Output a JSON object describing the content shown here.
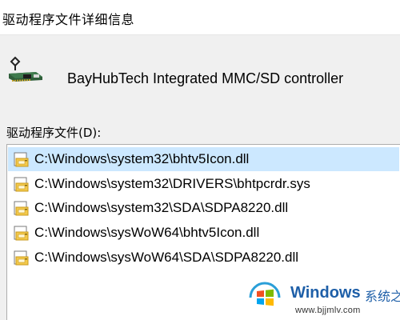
{
  "window": {
    "title": "驱动程序文件详细信息"
  },
  "device": {
    "icon": "controller-card-icon",
    "name": "BayHubTech Integrated MMC/SD controller"
  },
  "files": {
    "label": "驱动程序文件(D):",
    "selected_index": 0,
    "items": [
      {
        "path": "C:\\Windows\\system32\\bhtv5Icon.dll",
        "icon": "driver-file-icon"
      },
      {
        "path": "C:\\Windows\\system32\\DRIVERS\\bhtpcrdr.sys",
        "icon": "driver-file-icon"
      },
      {
        "path": "C:\\Windows\\system32\\SDA\\SDPA8220.dll",
        "icon": "driver-file-icon"
      },
      {
        "path": "C:\\Windows\\sysWoW64\\bhtv5Icon.dll",
        "icon": "driver-file-icon"
      },
      {
        "path": "C:\\Windows\\sysWoW64\\SDA\\SDPA8220.dll",
        "icon": "driver-file-icon"
      }
    ]
  },
  "watermark": {
    "brand": "Windows",
    "brand_cn": "系统之家",
    "url": "www.bjjmlv.com"
  },
  "colors": {
    "selection": "#cce8ff",
    "window_bg": "#f0f0f0",
    "brand_blue": "#1e5fa8"
  }
}
